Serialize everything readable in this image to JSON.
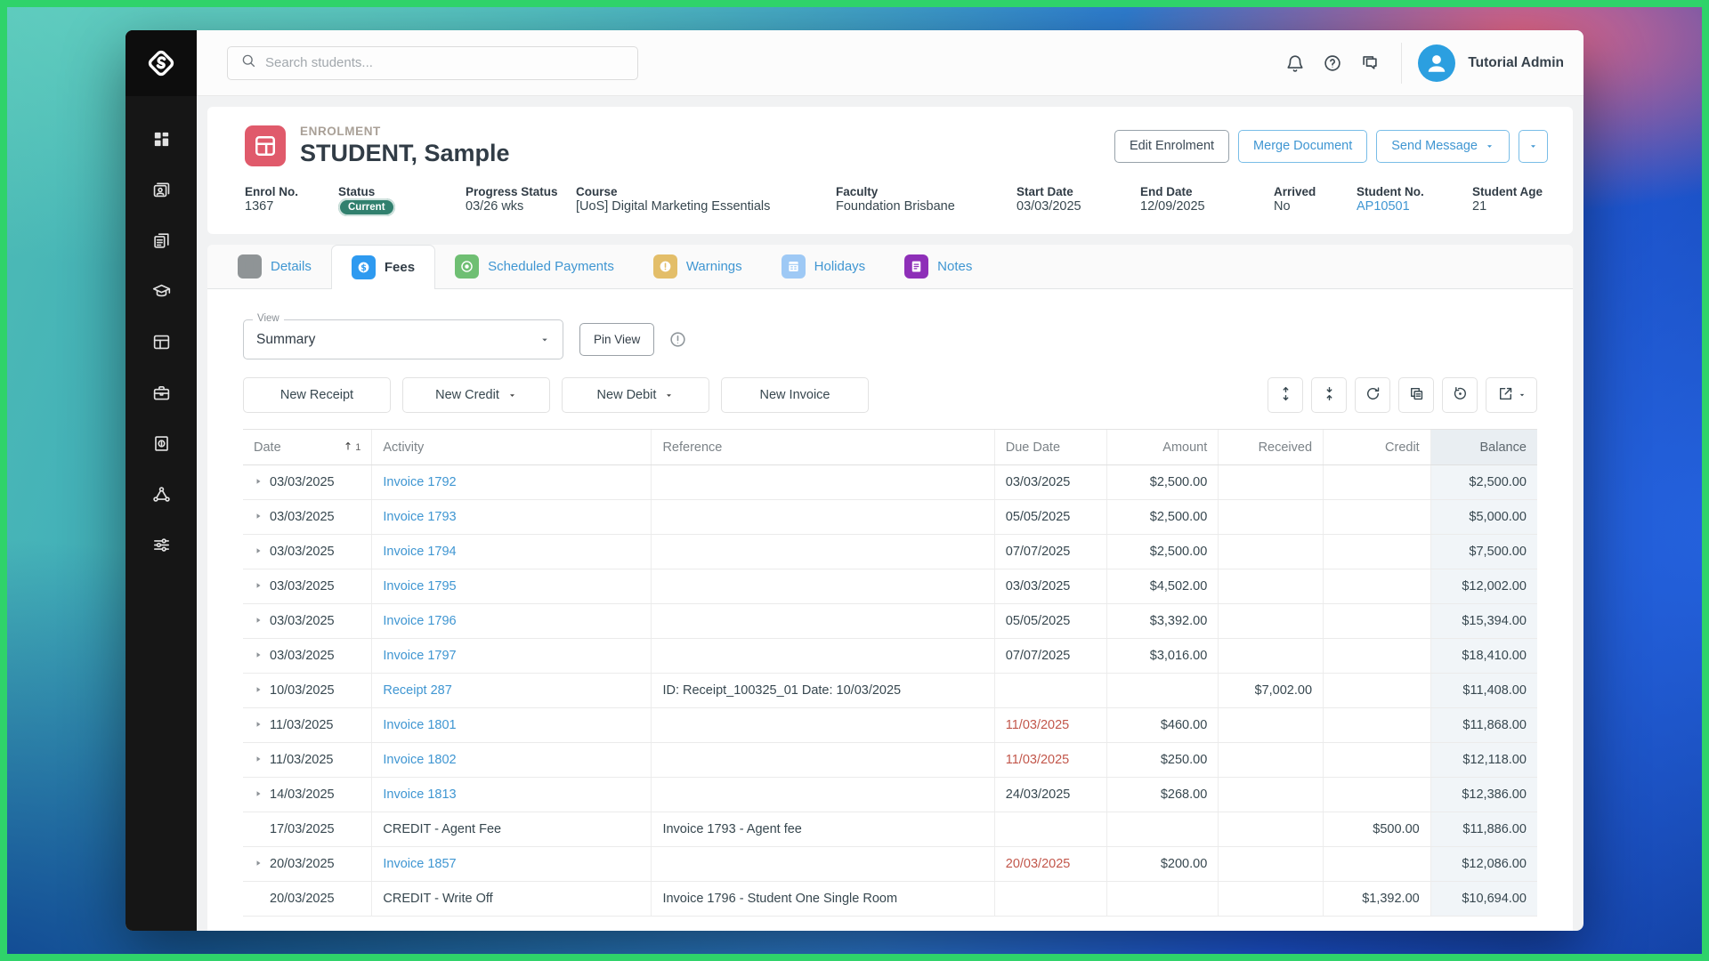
{
  "topbar": {
    "search_placeholder": "Search students...",
    "icons": [
      {
        "name": "notifications"
      },
      {
        "name": "help"
      },
      {
        "name": "messages"
      }
    ],
    "user_name": "Tutorial Admin"
  },
  "sidebar": {
    "items": [
      {
        "name": "dashboard"
      },
      {
        "name": "contacts"
      },
      {
        "name": "documents"
      },
      {
        "name": "courses"
      },
      {
        "name": "enrolments"
      },
      {
        "name": "agents"
      },
      {
        "name": "finance"
      },
      {
        "name": "network"
      },
      {
        "name": "settings"
      }
    ]
  },
  "header": {
    "eyebrow": "ENROLMENT",
    "title": "STUDENT, Sample",
    "actions": [
      {
        "label": "Edit Enrolment",
        "style": "neutral",
        "caret": false,
        "compact": false
      },
      {
        "label": "Merge Document",
        "style": "primary",
        "caret": false,
        "compact": false
      },
      {
        "label": "Send Message",
        "style": "primary",
        "caret": true,
        "compact": false
      },
      {
        "label": "",
        "style": "primary",
        "caret": true,
        "compact": true
      }
    ],
    "fields": [
      {
        "label": "Enrol No.",
        "value": "1367",
        "type": "text"
      },
      {
        "label": "Status",
        "value": "Current",
        "type": "badge"
      },
      {
        "label": "Progress Status",
        "value": "03/26 wks",
        "type": "text"
      },
      {
        "label": "Course",
        "value": "[UoS] Digital Marketing Essentials",
        "type": "text"
      },
      {
        "label": "Faculty",
        "value": "Foundation Brisbane",
        "type": "text"
      },
      {
        "label": "Start Date",
        "value": "03/03/2025",
        "type": "text"
      },
      {
        "label": "End Date",
        "value": "12/09/2025",
        "type": "text"
      },
      {
        "label": "Arrived",
        "value": "No",
        "type": "text"
      },
      {
        "label": "Student No.",
        "value": "AP10501",
        "type": "link"
      },
      {
        "label": "Student Age",
        "value": "21",
        "type": "text"
      }
    ]
  },
  "tabs": [
    {
      "label": "Details",
      "icon": "tab-details",
      "color": "#8f9496",
      "active": false
    },
    {
      "label": "Fees",
      "icon": "tab-fees",
      "color": "#2e9af0",
      "active": true
    },
    {
      "label": "Scheduled Payments",
      "icon": "tab-scheduled",
      "color": "#6fbf73",
      "active": false
    },
    {
      "label": "Warnings",
      "icon": "tab-warnings",
      "color": "#e3be69",
      "active": false
    },
    {
      "label": "Holidays",
      "icon": "tab-holidays",
      "color": "#9ec9f5",
      "active": false
    },
    {
      "label": "Notes",
      "icon": "tab-notes",
      "color": "#8e2fb8",
      "active": false
    }
  ],
  "toolbar": {
    "view_label": "View",
    "view_value": "Summary",
    "pin_view_label": "Pin View",
    "new_buttons": [
      {
        "label": "New Receipt",
        "caret": false
      },
      {
        "label": "New Credit",
        "caret": true
      },
      {
        "label": "New Debit",
        "caret": true
      },
      {
        "label": "New Invoice",
        "caret": false
      }
    ],
    "table_tools": [
      {
        "name": "expand-rows",
        "caret": false
      },
      {
        "name": "collapse-rows",
        "caret": false
      },
      {
        "name": "refresh",
        "caret": false
      },
      {
        "name": "duplicate",
        "caret": false
      },
      {
        "name": "history",
        "caret": false
      },
      {
        "name": "export",
        "caret": true
      }
    ]
  },
  "table": {
    "columns": [
      {
        "label": "Date",
        "key": "date",
        "align": "left",
        "sort": "1",
        "highlight": false
      },
      {
        "label": "Activity",
        "key": "activity",
        "align": "left",
        "highlight": false
      },
      {
        "label": "Reference",
        "key": "reference",
        "align": "left",
        "highlight": false
      },
      {
        "label": "Due Date",
        "key": "due_date",
        "align": "left",
        "highlight": false
      },
      {
        "label": "Amount",
        "key": "amount",
        "align": "right",
        "highlight": false
      },
      {
        "label": "Received",
        "key": "received",
        "align": "right",
        "highlight": false
      },
      {
        "label": "Credit",
        "key": "credit",
        "align": "right",
        "highlight": false
      },
      {
        "label": "Balance",
        "key": "balance",
        "align": "right",
        "highlight": true
      }
    ],
    "rows": [
      {
        "expandable": true,
        "date": "03/03/2025",
        "activity": "Invoice 1792",
        "link": true,
        "reference": "",
        "due_date": "03/03/2025",
        "overdue": false,
        "amount": "$2,500.00",
        "received": "",
        "credit": "",
        "balance": "$2,500.00"
      },
      {
        "expandable": true,
        "date": "03/03/2025",
        "activity": "Invoice 1793",
        "link": true,
        "reference": "",
        "due_date": "05/05/2025",
        "overdue": false,
        "amount": "$2,500.00",
        "received": "",
        "credit": "",
        "balance": "$5,000.00"
      },
      {
        "expandable": true,
        "date": "03/03/2025",
        "activity": "Invoice 1794",
        "link": true,
        "reference": "",
        "due_date": "07/07/2025",
        "overdue": false,
        "amount": "$2,500.00",
        "received": "",
        "credit": "",
        "balance": "$7,500.00"
      },
      {
        "expandable": true,
        "date": "03/03/2025",
        "activity": "Invoice 1795",
        "link": true,
        "reference": "",
        "due_date": "03/03/2025",
        "overdue": false,
        "amount": "$4,502.00",
        "received": "",
        "credit": "",
        "balance": "$12,002.00"
      },
      {
        "expandable": true,
        "date": "03/03/2025",
        "activity": "Invoice 1796",
        "link": true,
        "reference": "",
        "due_date": "05/05/2025",
        "overdue": false,
        "amount": "$3,392.00",
        "received": "",
        "credit": "",
        "balance": "$15,394.00"
      },
      {
        "expandable": true,
        "date": "03/03/2025",
        "activity": "Invoice 1797",
        "link": true,
        "reference": "",
        "due_date": "07/07/2025",
        "overdue": false,
        "amount": "$3,016.00",
        "received": "",
        "credit": "",
        "balance": "$18,410.00"
      },
      {
        "expandable": true,
        "date": "10/03/2025",
        "activity": "Receipt 287",
        "link": true,
        "reference": "ID: Receipt_100325_01 Date: 10/03/2025",
        "due_date": "",
        "overdue": false,
        "amount": "",
        "received": "$7,002.00",
        "credit": "",
        "balance": "$11,408.00"
      },
      {
        "expandable": true,
        "date": "11/03/2025",
        "activity": "Invoice 1801",
        "link": true,
        "reference": "",
        "due_date": "11/03/2025",
        "overdue": true,
        "amount": "$460.00",
        "received": "",
        "credit": "",
        "balance": "$11,868.00"
      },
      {
        "expandable": true,
        "date": "11/03/2025",
        "activity": "Invoice 1802",
        "link": true,
        "reference": "",
        "due_date": "11/03/2025",
        "overdue": true,
        "amount": "$250.00",
        "received": "",
        "credit": "",
        "balance": "$12,118.00"
      },
      {
        "expandable": true,
        "date": "14/03/2025",
        "activity": "Invoice 1813",
        "link": true,
        "reference": "",
        "due_date": "24/03/2025",
        "overdue": false,
        "amount": "$268.00",
        "received": "",
        "credit": "",
        "balance": "$12,386.00"
      },
      {
        "expandable": false,
        "date": "17/03/2025",
        "activity": "CREDIT - Agent Fee",
        "link": false,
        "reference": "Invoice 1793 - Agent fee",
        "due_date": "",
        "overdue": false,
        "amount": "",
        "received": "",
        "credit": "$500.00",
        "balance": "$11,886.00"
      },
      {
        "expandable": true,
        "date": "20/03/2025",
        "activity": "Invoice 1857",
        "link": true,
        "reference": "",
        "due_date": "20/03/2025",
        "overdue": true,
        "amount": "$200.00",
        "received": "",
        "credit": "",
        "balance": "$12,086.00"
      },
      {
        "expandable": false,
        "date": "20/03/2025",
        "activity": "CREDIT - Write Off",
        "link": false,
        "reference": "Invoice 1796 - Student One Single Room",
        "due_date": "",
        "overdue": false,
        "amount": "",
        "received": "",
        "credit": "$1,392.00",
        "balance": "$10,694.00"
      }
    ]
  },
  "colors": {
    "accent_blue": "#3f96d2",
    "badge_green": "#31806e",
    "overdue_red": "#c2574b",
    "entity_red": "#e05a6b",
    "avatar_blue": "#2b9fe0",
    "frame_green": "#2fd36a"
  }
}
